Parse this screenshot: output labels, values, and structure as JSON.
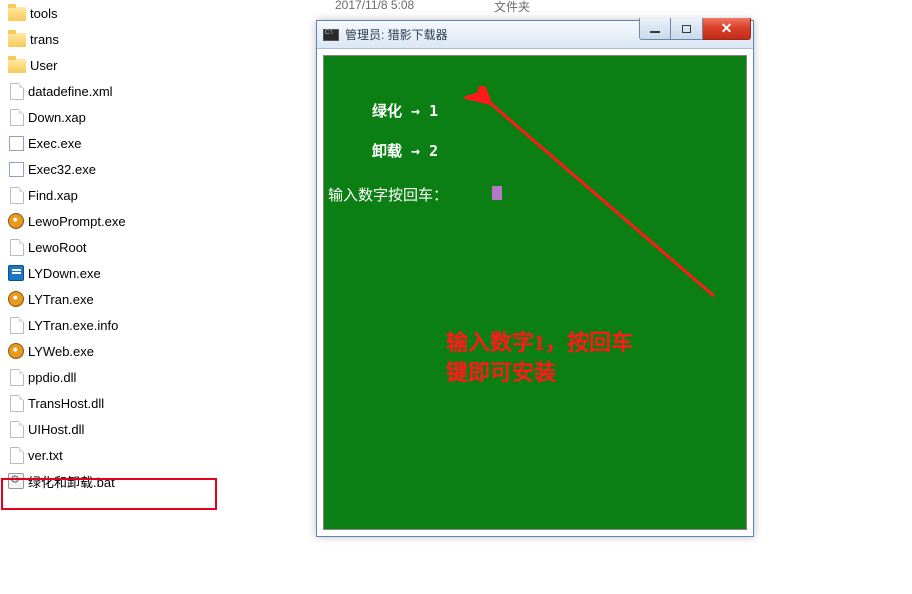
{
  "header": {
    "date": "2017/11/8 5:08",
    "type_label": "文件夹"
  },
  "files": [
    {
      "name": "tools",
      "icon": "folder"
    },
    {
      "name": "trans",
      "icon": "folder"
    },
    {
      "name": "User",
      "icon": "folder"
    },
    {
      "name": "datadefine.xml",
      "icon": "file"
    },
    {
      "name": "Down.xap",
      "icon": "file"
    },
    {
      "name": "Exec.exe",
      "icon": "exe-blank"
    },
    {
      "name": "Exec32.exe",
      "icon": "exe-blank"
    },
    {
      "name": "Find.xap",
      "icon": "file"
    },
    {
      "name": "LewoPrompt.exe",
      "icon": "exe-disc"
    },
    {
      "name": "LewoRoot",
      "icon": "file"
    },
    {
      "name": "LYDown.exe",
      "icon": "exe-blue"
    },
    {
      "name": "LYTran.exe",
      "icon": "exe-disc"
    },
    {
      "name": "LYTran.exe.info",
      "icon": "file"
    },
    {
      "name": "LYWeb.exe",
      "icon": "exe-disc"
    },
    {
      "name": "ppdio.dll",
      "icon": "file"
    },
    {
      "name": "TransHost.dll",
      "icon": "file"
    },
    {
      "name": "UIHost.dll",
      "icon": "file"
    },
    {
      "name": "ver.txt",
      "icon": "file"
    },
    {
      "name": "绿化和卸载.bat",
      "icon": "bat"
    }
  ],
  "window": {
    "title": "管理员: 猎影下载器",
    "line1": "绿化 → 1",
    "line2": "卸载 → 2",
    "prompt": "输入数字按回车："
  },
  "annotation": {
    "line1": "输入数字1，按回车",
    "line2": "键即可安装"
  }
}
